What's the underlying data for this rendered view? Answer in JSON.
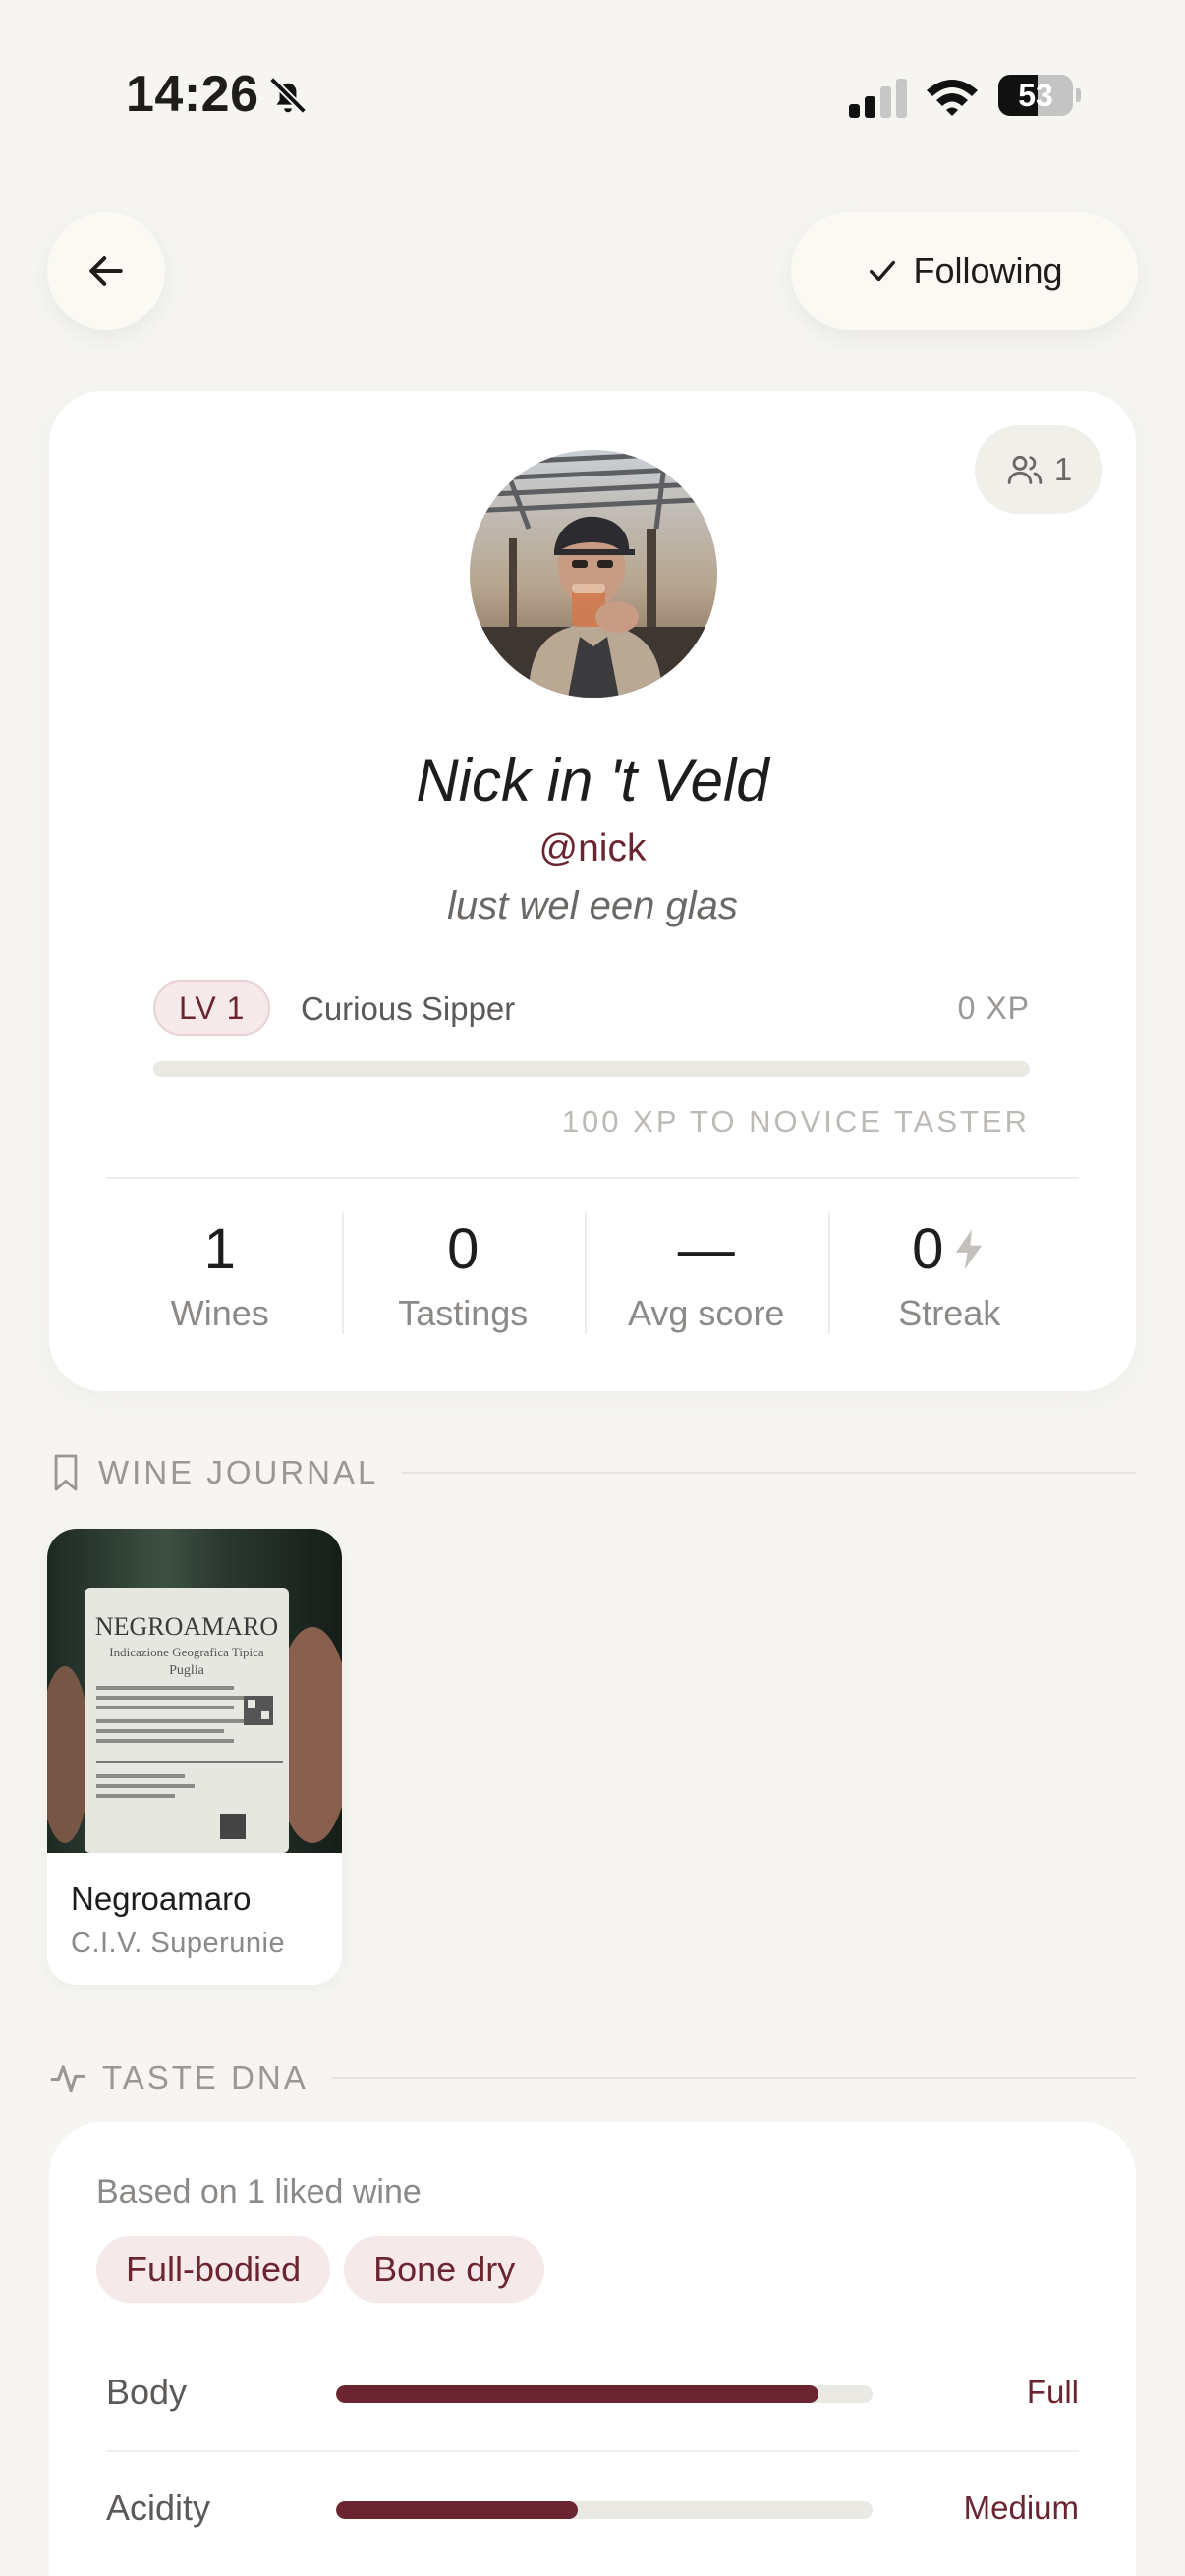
{
  "status_bar": {
    "time": "14:26",
    "battery_level": "53",
    "battery_fraction": 0.53
  },
  "nav": {
    "follow_label": "Following"
  },
  "profile": {
    "followers_count": "1",
    "display_name": "Nick in 't Veld",
    "handle": "@nick",
    "bio": "lust wel een glas",
    "level_badge": "LV 1",
    "level_title": "Curious Sipper",
    "xp": "0 XP",
    "xp_progress": 0.0,
    "xp_next": "100 XP TO NOVICE TASTER"
  },
  "stats": [
    {
      "value": "1",
      "label": "Wines"
    },
    {
      "value": "0",
      "label": "Tastings"
    },
    {
      "value": "—",
      "label": "Avg score"
    },
    {
      "value": "0",
      "label": "Streak"
    }
  ],
  "wine_journal": {
    "title": "WINE JOURNAL",
    "wines": [
      {
        "name": "Negroamaro",
        "producer": "C.I.V. Superunie",
        "label_main": "NEGROAMARO",
        "label_sub": "Indicazione Geografica Tipica",
        "label_region": "Puglia"
      }
    ]
  },
  "taste_dna": {
    "title": "TASTE DNA",
    "basis": "Based on 1 liked wine",
    "tags": [
      "Full-bodied",
      "Bone dry"
    ],
    "traits": [
      {
        "label": "Body",
        "value": "Full",
        "level": 0.9
      },
      {
        "label": "Acidity",
        "value": "Medium",
        "level": 0.45
      }
    ]
  },
  "colors": {
    "accent": "#6b2530",
    "background": "#f6f5f1",
    "card": "#ffffff",
    "tag_bg": "#f6e9ea"
  }
}
